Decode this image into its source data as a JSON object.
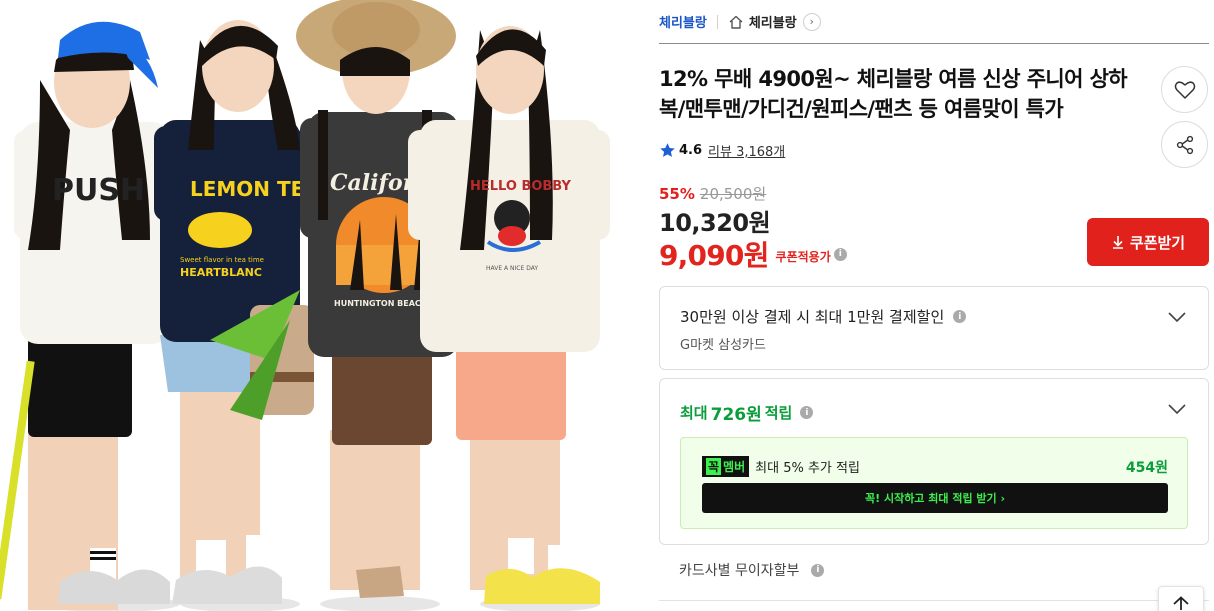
{
  "breadcrumb": {
    "brand": "체리블랑",
    "shop": "체리블랑",
    "home_icon": "home-icon",
    "arrow_icon": "chevron-right-icon"
  },
  "product": {
    "title": "12% 무배 4900원~ 체리블랑 여름 신상 주니어 상하복/맨투맨/가디건/원피스/팬츠 등 여름맞이 특가",
    "image_texts": [
      "PUSH",
      "LEMON TEA",
      "Sweet flavor in tea time",
      "HEARTBLANC",
      "California",
      "HUNTINGTON BEACH",
      "HELLO BOBBY",
      "HAVE A NICE DAY"
    ]
  },
  "actions": {
    "wish_icon": "heart-icon",
    "share_icon": "share-icon"
  },
  "rating": {
    "score": "4.6",
    "review_label": "리뷰 3,168개"
  },
  "price": {
    "discount_rate": "55%",
    "original": "20,500원",
    "sale": "10,320원",
    "coupon_price": "9,090원",
    "coupon_label": "쿠폰적용가",
    "coupon_button": "쿠폰받기"
  },
  "card_benefit": {
    "title": "30만원 이상 결제 시 최대 1만원 결제할인",
    "subtitle": "G마켓 삼성카드"
  },
  "points": {
    "prefix": "최대",
    "amount": "726원",
    "suffix": "적립",
    "club_badge_a": "꼭",
    "club_badge_b": "멤버",
    "club_text": "최대 5% 추가 적립",
    "club_amount": "454원",
    "club_cta": "꼭! 시작하고 최대 적립 받기 ›"
  },
  "installment": {
    "label": "카드사별 무이자할부"
  },
  "colors": {
    "accent_red": "#e1211c",
    "brand_blue": "#1a56c8",
    "point_green": "#0b9d3b",
    "club_green": "#3cf04e"
  }
}
